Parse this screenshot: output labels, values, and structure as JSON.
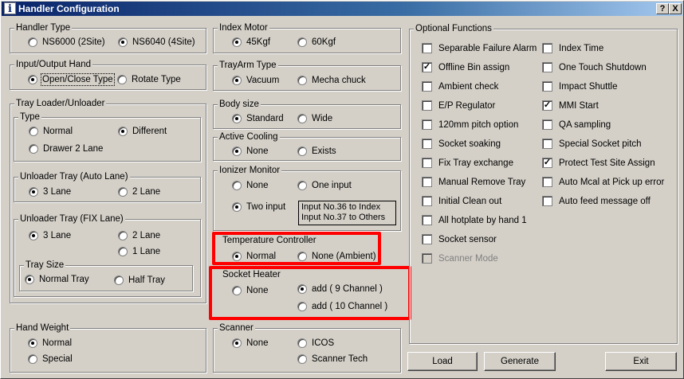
{
  "window": {
    "title": "Handler Configuration",
    "help_label": "?",
    "close_label": "X"
  },
  "handler_type": {
    "label": "Handler Type",
    "options": [
      {
        "label": "NS6000 (2Site)",
        "selected": false
      },
      {
        "label": "NS6040 (4Site)",
        "selected": true
      }
    ]
  },
  "io_hand": {
    "label": "Input/Output  Hand",
    "options": [
      {
        "label": "Open/Close Type",
        "selected": true
      },
      {
        "label": "Rotate Type",
        "selected": false
      }
    ]
  },
  "tray_loader": {
    "label": "Tray Loader/Unloader",
    "type": {
      "label": "Type",
      "options": [
        {
          "label": "Normal",
          "selected": false
        },
        {
          "label": "Different",
          "selected": true
        },
        {
          "label": "Drawer 2 Lane",
          "selected": false
        }
      ]
    },
    "unloader_auto": {
      "label": "Unloader Tray (Auto Lane)",
      "options": [
        {
          "label": "3 Lane",
          "selected": true
        },
        {
          "label": "2 Lane",
          "selected": false
        }
      ]
    },
    "unloader_fix": {
      "label": "Unloader Tray (FIX Lane)",
      "options": [
        {
          "label": "3 Lane",
          "selected": true
        },
        {
          "label": "2 Lane",
          "selected": false
        },
        {
          "label": "1 Lane",
          "selected": false
        }
      ]
    },
    "tray_size": {
      "label": "Tray Size",
      "options": [
        {
          "label": "Normal Tray",
          "selected": true
        },
        {
          "label": "Half Tray",
          "selected": false
        }
      ]
    }
  },
  "hand_weight": {
    "label": "Hand Weight",
    "options": [
      {
        "label": "Normal",
        "selected": true
      },
      {
        "label": "Special",
        "selected": false
      }
    ]
  },
  "index_motor": {
    "label": "Index Motor",
    "options": [
      {
        "label": "45Kgf",
        "selected": true
      },
      {
        "label": "60Kgf",
        "selected": false
      }
    ]
  },
  "trayarm_type": {
    "label": "TrayArm Type",
    "options": [
      {
        "label": "Vacuum",
        "selected": true
      },
      {
        "label": "Mecha chuck",
        "selected": false
      }
    ]
  },
  "body_size": {
    "label": "Body size",
    "options": [
      {
        "label": "Standard",
        "selected": true
      },
      {
        "label": "Wide",
        "selected": false
      }
    ]
  },
  "active_cooling": {
    "label": "Active Cooling",
    "options": [
      {
        "label": "None",
        "selected": true
      },
      {
        "label": "Exists",
        "selected": false
      }
    ]
  },
  "ionizer": {
    "label": "Ionizer Monitor",
    "options": [
      {
        "label": "None",
        "selected": false
      },
      {
        "label": "One input",
        "selected": false
      },
      {
        "label": "Two input",
        "selected": true
      }
    ],
    "info_line1": "Input No.36 to Index",
    "info_line2": "Input No.37 to Others"
  },
  "temperature": {
    "label": "Temperature Controller",
    "options": [
      {
        "label": "Normal",
        "selected": true
      },
      {
        "label": "None (Ambient)",
        "selected": false
      }
    ]
  },
  "socket_heater": {
    "label": "Socket Heater",
    "options": [
      {
        "label": "None",
        "selected": false
      },
      {
        "label": "add ( 9 Channel )",
        "selected": true
      },
      {
        "label": "add ( 10 Channel )",
        "selected": false
      }
    ]
  },
  "scanner": {
    "label": "Scanner",
    "options": [
      {
        "label": "None",
        "selected": true
      },
      {
        "label": "ICOS",
        "selected": false
      },
      {
        "label": "Scanner Tech",
        "selected": false
      }
    ]
  },
  "optional": {
    "label": "Optional Functions",
    "left": [
      {
        "label": "Separable Failure Alarm",
        "checked": false
      },
      {
        "label": "Offline Bin assign",
        "checked": true
      },
      {
        "label": "Ambient check",
        "checked": false
      },
      {
        "label": "E/P Regulator",
        "checked": false
      },
      {
        "label": "120mm pitch option",
        "checked": false
      },
      {
        "label": "Socket soaking",
        "checked": false
      },
      {
        "label": "Fix Tray exchange",
        "checked": false
      },
      {
        "label": "Manual Remove Tray",
        "checked": false
      },
      {
        "label": "Initial Clean out",
        "checked": false
      },
      {
        "label": "All hotplate by hand 1",
        "checked": false
      },
      {
        "label": "Socket sensor",
        "checked": false
      },
      {
        "label": "Scanner Mode",
        "checked": false,
        "disabled": true
      }
    ],
    "right": [
      {
        "label": "Index Time",
        "checked": false
      },
      {
        "label": "One Touch Shutdown",
        "checked": false
      },
      {
        "label": "Impact Shuttle",
        "checked": false
      },
      {
        "label": "MMI Start",
        "checked": true
      },
      {
        "label": "QA sampling",
        "checked": false
      },
      {
        "label": "Special Socket pitch",
        "checked": false
      },
      {
        "label": "Protect Test Site Assign",
        "checked": true
      },
      {
        "label": "Auto Mcal at Pick up error",
        "checked": false
      },
      {
        "label": "Auto feed message off",
        "checked": false
      }
    ]
  },
  "buttons": {
    "load": "Load",
    "generate": "Generate",
    "exit": "Exit"
  },
  "colors": {
    "title_bar": "#0a246a",
    "dialog_face": "#d4d0c8",
    "highlight": "#ff0000"
  }
}
